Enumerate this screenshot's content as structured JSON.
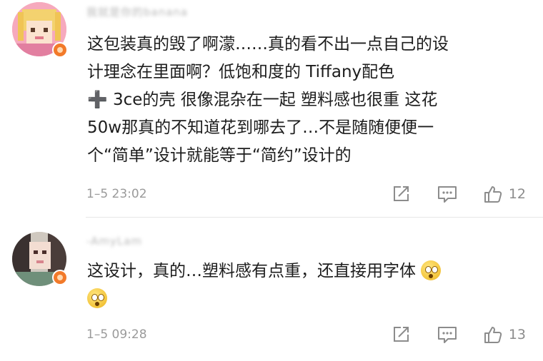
{
  "comments": [
    {
      "username": "我就是你的banana",
      "text_lines": [
        "这包装真的毁了啊濛……真的看不出一点自己的设",
        "计理念在里面啊？低饱和度的 Tiffany配色",
        "3ce的壳 很像混杂在一起 塑料感也很重  这花",
        "50w那真的不知道花到哪去了…不是随随便便一",
        "个“简单”设计就能等于“简约”设计的"
      ],
      "plus_symbol": "➕",
      "timestamp": "1–5 23:02",
      "like_count": "12"
    },
    {
      "username": "-AmyLam",
      "text_lines": [
        "这设计，真的…塑料感有点重，还直接用字体"
      ],
      "emoji": "flushed-face",
      "timestamp": "1–5 09:28",
      "like_count": "13"
    }
  ],
  "icons": {
    "share": "share-icon",
    "reply": "comment-icon",
    "like": "thumbs-up-icon"
  },
  "colors": {
    "meta_gray": "#9a9a9a",
    "text": "#1d1d1d",
    "badge": "#f27a2a"
  }
}
